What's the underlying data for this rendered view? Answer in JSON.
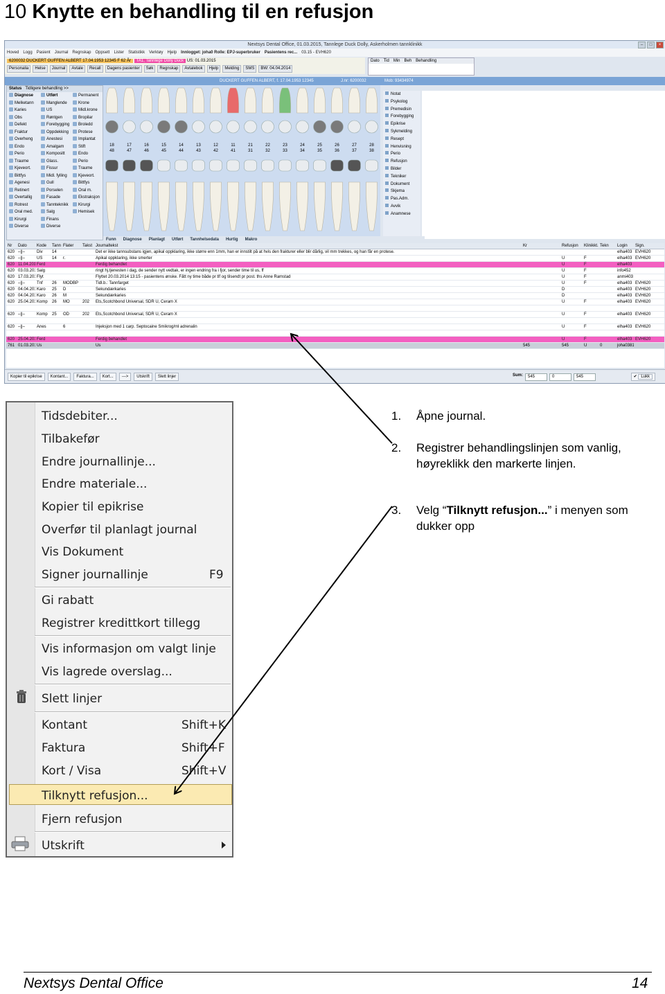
{
  "heading": {
    "number": "10",
    "title": "Knytte en behandling til en refusjon"
  },
  "app": {
    "title": "Nextsys Dental Office, 01.03.2015, Tannlege Duck Dolly, Askerholmen tannklinikk",
    "menu": [
      "Hoved",
      "Logg",
      "Pasient",
      "Journal",
      "Regnskap",
      "Oppsett",
      "Lister",
      "Statistikk",
      "Verktøy",
      "Hjelp"
    ],
    "login": "Innlogget: joha0 Rolle: EPJ-superbruker",
    "patient_rec": "Pasientens rec...",
    "patient_rec_value": "03.15 - EVH620",
    "patient_line": "6200032 DUCKERT GUFFEN ALBERT 17.04.1953 12345  F 62 År",
    "practitioner": "TA1, Tannlege Dolly Duck",
    "us_date": "US: 01.03.2015",
    "bw_date": "BW: 04.04.2014",
    "toolbar": [
      "Personalia",
      "Helse",
      "Journal",
      "Avtale",
      "Recall",
      "Dagens pasienter",
      "Søk",
      "Regnskap",
      "Avtalebok",
      "Hjelp",
      "Melding",
      "SMS"
    ],
    "date_table_headers": [
      "Dato",
      "Tid",
      "Min",
      "Beh",
      "Behandling"
    ],
    "name_bar": "DUCKERT GUFFEN ALBERT, f. 17.04.1953 12345",
    "journal_nr": "J.nr: 6200032",
    "mobile": "Mob: 93434974",
    "sub_bar": "03.15 - EVH620",
    "left_tabs": [
      "Status",
      "Tidligere behandling >>"
    ],
    "left_header": [
      "Diagnose",
      "Utført"
    ],
    "left_col1": [
      "Melketann",
      "Karies",
      "Obs",
      "Defekt",
      "Fraktur",
      "Overheng",
      "Endo",
      "Perio",
      "Traume",
      "Kjeveort.",
      "Bittfys",
      "Agenesi",
      "Retinert",
      "Overtallig",
      "Rotrest",
      "Oral med.",
      "Kirurgi",
      "Diverse"
    ],
    "left_col2": [
      "Manglende",
      "US",
      "Røntgen",
      "Forebygging",
      "Oppdekking",
      "Anestesi",
      "Amalgam",
      "Kompositt",
      "Glass.",
      "Fissur",
      "Midl. fylling",
      "Gull",
      "Porselen",
      "Fasade",
      "Tannteknikk",
      "Salg",
      "Finans",
      "Diverse"
    ],
    "left_col3": [
      "Permanent",
      "Krone",
      "Midl.krone",
      "Bropilar",
      "Broledd",
      "Protese",
      "Implantat",
      "Stift",
      "Endo",
      "Perio",
      "Traume",
      "Kjeveort.",
      "Bittfys",
      "Oral m.",
      "Ekstraksjon",
      "Kirurgi",
      "Hemisek"
    ],
    "tooth_upper": [
      "18",
      "17",
      "16",
      "15",
      "14",
      "13",
      "12",
      "11",
      "21",
      "22",
      "23",
      "24",
      "25",
      "26",
      "27",
      "28"
    ],
    "tooth_lower": [
      "48",
      "47",
      "46",
      "45",
      "44",
      "43",
      "42",
      "41",
      "31",
      "32",
      "33",
      "34",
      "35",
      "36",
      "37",
      "38"
    ],
    "right_items": [
      "Notat",
      "Psykolog",
      "Premedisin",
      "Forebygging",
      "Epikrise",
      "Sykmelding",
      "Resept",
      "Henvisning",
      "Perio",
      "Refusjon",
      "Bilder",
      "Tekniker",
      "Dokument",
      "Skjema",
      "Pas.Adm.",
      "Avvik",
      "Anamnese"
    ],
    "tabs": [
      "Funn",
      "Diagnose",
      "Planlagt",
      "Utført",
      "Tannhelsedata",
      "Hurtig",
      "Makro"
    ],
    "journal_headers": [
      "Nr",
      "Dato",
      "Kode",
      "Tann",
      "Flater",
      "Takst",
      "Journaltekst",
      "Kr",
      "Refusjon",
      "Klinikkt.",
      "Tekn",
      "Login",
      "Sign."
    ],
    "journal_rows": [
      {
        "style": "",
        "cells": [
          "620",
          "–||–",
          "Div",
          "14",
          "",
          "",
          "Det er ikke tannsubstans igjen, apikal oppklaring, ikke større enn 1mm, han er innstilt på at hvis den frakturer eller blir dårlig, vil mm trekkes, og han får en protese.",
          "",
          "",
          "",
          "",
          "elha403",
          "EVH620"
        ]
      },
      {
        "style": "",
        "cells": [
          "620",
          "–||–",
          "US",
          "14",
          "r.",
          "",
          "Apikal oppklaring, ikke smerter",
          "",
          "U",
          "F",
          "",
          "elha403",
          "EVH620"
        ]
      },
      {
        "style": "pink",
        "cells": [
          "620",
          "11.04.2013",
          "Ferd",
          "",
          "",
          "",
          "Ferdig behandlet",
          "",
          "U",
          "F",
          "",
          "elha403",
          ""
        ]
      },
      {
        "style": "",
        "cells": [
          "620",
          "03.03.2014",
          "Salg",
          "",
          "",
          "",
          "ringt hj.tjenesten i dag, de sender nytt vedtak, er ingen endring fra i fjor, sender time til us, ff",
          "",
          "U",
          "F",
          "",
          "info452",
          ""
        ]
      },
      {
        "style": "",
        "cells": [
          "620",
          "17.03.2014",
          "Flyt",
          "",
          "",
          "",
          "Flyttet 20.03.2014 13:15 - pasientens ønske. Fått ny time både pr tlf og tilsendt pr post. ths Anne Ramstad",
          "",
          "U",
          "F",
          "",
          "anmi403",
          ""
        ]
      },
      {
        "style": "",
        "cells": [
          "620",
          "–||–",
          "Tnf",
          "26",
          "MODBP",
          "",
          "Tidl.b.: Tannfarget",
          "",
          "U",
          "F",
          "",
          "elha403",
          "EVH620"
        ]
      },
      {
        "style": "",
        "cells": [
          "620",
          "04.04.2014",
          "Karo",
          "25",
          "D",
          "",
          "Sekundærkaries",
          "",
          "D",
          "",
          "",
          "elha403",
          "EVH620"
        ]
      },
      {
        "style": "",
        "cells": [
          "620",
          "04.04.2014",
          "Karo",
          "26",
          "M",
          "",
          "Sekundærkaries",
          "",
          "D",
          "",
          "",
          "elha403",
          "EVH620"
        ]
      },
      {
        "style": "",
        "cells": [
          "620",
          "25.04.2014",
          "Komp",
          "26",
          "MO",
          "202",
          "Ets,Scotchbond Universal, SDR U, Ceram X",
          "",
          "U",
          "F",
          "",
          "elha403",
          "EVH620"
        ]
      },
      {
        "style": "",
        "cells": [
          "",
          "",
          "",
          "",
          "",
          "",
          "",
          "",
          "",
          "",
          "",
          "",
          ""
        ]
      },
      {
        "style": "",
        "cells": [
          "620",
          "–||–",
          "Komp",
          "25",
          "OD",
          "202",
          "Ets,Scotchbond Universal, SDR U, Ceram X",
          "",
          "U",
          "F",
          "",
          "elha403",
          "EVH620"
        ]
      },
      {
        "style": "",
        "cells": [
          "",
          "",
          "",
          "",
          "",
          "",
          "",
          "",
          "",
          "",
          "",
          "",
          ""
        ]
      },
      {
        "style": "",
        "cells": [
          "620",
          "–||–",
          "Anes",
          "",
          "6",
          "",
          "Injeksjon med 1 carp. Septocaine  Smikrog/ml adrenalin",
          "",
          "U",
          "F",
          "",
          "elha403",
          "EVH620"
        ]
      },
      {
        "style": "",
        "cells": [
          "",
          "",
          "",
          "",
          "",
          "",
          "",
          "",
          "",
          "",
          "",
          "",
          ""
        ]
      },
      {
        "style": "pink",
        "cells": [
          "620",
          "25.04.2014",
          "Ferd",
          "",
          "",
          "",
          "Ferdig behandlet",
          "",
          "U",
          "F",
          "",
          "elha403",
          "EVH620"
        ]
      },
      {
        "style": "sel",
        "cells": [
          "761",
          "01.03.2015",
          "Us",
          "",
          "",
          "",
          "Us",
          "545",
          "545",
          "U",
          "0",
          "joha0381",
          ""
        ]
      }
    ],
    "bottom_buttons": [
      "Kopier til epikrise",
      "Kontant...",
      "Faktura...",
      "Kort...",
      "--->",
      "Utskrift",
      "Slett linjer"
    ],
    "sum_label": "Sum:",
    "sum_values": [
      "545",
      "0",
      "545"
    ],
    "close_label": "Lukk"
  },
  "context_menu": {
    "items": [
      {
        "label": "Tidsdebiter...",
        "shortcut": ""
      },
      {
        "label": "Tilbakefør",
        "shortcut": ""
      },
      {
        "label": "Endre journallinje...",
        "shortcut": ""
      },
      {
        "label": "Endre materiale...",
        "shortcut": ""
      },
      {
        "label": "Kopier til epikrise",
        "shortcut": ""
      },
      {
        "label": "Overfør til planlagt journal",
        "shortcut": ""
      },
      {
        "label": "Vis Dokument",
        "shortcut": ""
      },
      {
        "label": "Signer journallinje",
        "shortcut": "F9"
      },
      {
        "label": "Gi rabatt",
        "shortcut": ""
      },
      {
        "label": "Registrer kredittkort tillegg",
        "shortcut": ""
      },
      {
        "label": "Vis informasjon om valgt linje",
        "shortcut": ""
      },
      {
        "label": "Vis lagrede overslag...",
        "shortcut": ""
      },
      {
        "label": "Slett linjer",
        "shortcut": ""
      },
      {
        "label": "Kontant",
        "shortcut": "Shift+K"
      },
      {
        "label": "Faktura",
        "shortcut": "Shift+F"
      },
      {
        "label": "Kort / Visa",
        "shortcut": "Shift+V"
      },
      {
        "label": "Tilknytt refusjon...",
        "shortcut": ""
      },
      {
        "label": "Fjern refusjon",
        "shortcut": ""
      },
      {
        "label": "Utskrift",
        "shortcut": ""
      }
    ],
    "highlighted": "Tilknytt refusjon..."
  },
  "steps": [
    {
      "number": "1.",
      "text": "Åpne journal."
    },
    {
      "number": "2.",
      "text": "Registrer behandlingslinjen som vanlig, høyreklikk den markerte linjen."
    },
    {
      "number": "3.",
      "prefix": "Velg “",
      "bold": "Tilknytt refusjon...",
      "suffix": "” i menyen som dukker opp"
    }
  ],
  "footer": {
    "left": "Nextsys Dental Office",
    "right": "14"
  }
}
